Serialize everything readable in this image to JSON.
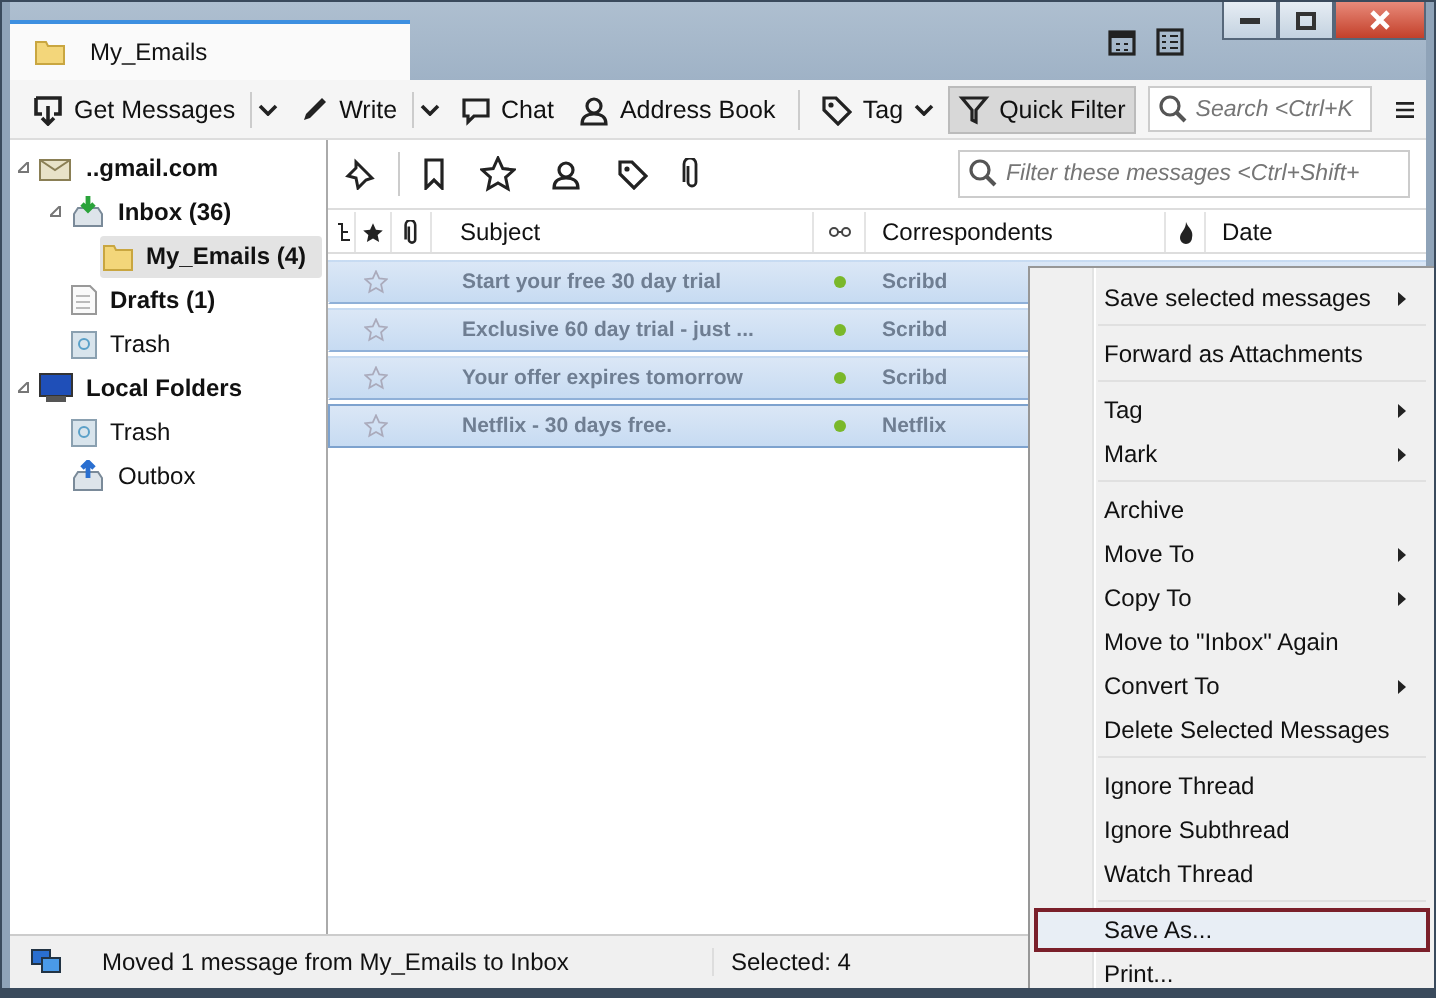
{
  "window": {
    "tab_title": "My_Emails"
  },
  "toolbar": {
    "buttons": [
      {
        "label": "Get Messages",
        "kind": "get",
        "dropdown": true
      },
      {
        "label": "Write",
        "kind": "write",
        "dropdown": true
      },
      {
        "label": "Chat",
        "kind": "chat",
        "dropdown": false
      },
      {
        "label": "Address Book",
        "kind": "contacts",
        "dropdown": false
      },
      {
        "label": "Tag",
        "kind": "tag",
        "dropdown": true
      },
      {
        "label": "Quick Filter",
        "kind": "filter",
        "dropdown": false,
        "on": true
      }
    ],
    "search": {
      "placeholder": "Search <Ctrl+K"
    }
  },
  "folders": [
    {
      "label": "..gmail.com",
      "kind": "account",
      "bold": true,
      "selected": false,
      "expanded": true,
      "children": [
        {
          "label": "Inbox (36)",
          "kind": "inbox",
          "bold": true,
          "selected": false,
          "expanded": true,
          "children": [
            {
              "label": "My_Emails (4)",
              "kind": "folder",
              "bold": true,
              "selected": true
            }
          ]
        },
        {
          "label": "Drafts (1)",
          "kind": "drafts",
          "bold": true,
          "selected": false
        },
        {
          "label": "Trash",
          "kind": "trash",
          "bold": false,
          "selected": false
        }
      ]
    },
    {
      "label": "Local Folders",
      "kind": "local",
      "bold": true,
      "selected": false,
      "expanded": true,
      "children": [
        {
          "label": "Trash",
          "kind": "trash",
          "bold": false,
          "selected": false
        },
        {
          "label": "Outbox",
          "kind": "outbox",
          "bold": false,
          "selected": false
        }
      ]
    }
  ],
  "filter": {
    "placeholder": "Filter these messages <Ctrl+Shift+"
  },
  "columns": [
    {
      "label": "Subject"
    },
    {
      "label": "Correspondents"
    },
    {
      "label": "Date"
    }
  ],
  "messages": [
    {
      "subject": "Start your free 30 day trial",
      "correspondent": "Scribd",
      "selected": true,
      "focused": false
    },
    {
      "subject": "Exclusive 60 day trial - just ...",
      "correspondent": "Scribd",
      "selected": true,
      "focused": false
    },
    {
      "subject": "Your offer expires tomorrow",
      "correspondent": "Scribd",
      "selected": true,
      "focused": false
    },
    {
      "subject": "Netflix - 30 days free.",
      "correspondent": "Netflix",
      "selected": true,
      "focused": true
    }
  ],
  "context_menu": {
    "groups": [
      [
        {
          "label": "Save selected messages",
          "submenu": true,
          "highlighted": false
        }
      ],
      [
        {
          "label": "Forward as Attachments",
          "submenu": false,
          "highlighted": false
        }
      ],
      [
        {
          "label": "Tag",
          "submenu": true,
          "highlighted": false
        },
        {
          "label": "Mark",
          "submenu": true,
          "highlighted": false
        }
      ],
      [
        {
          "label": "Archive",
          "submenu": false,
          "highlighted": false
        },
        {
          "label": "Move To",
          "submenu": true,
          "highlighted": false
        },
        {
          "label": "Copy To",
          "submenu": true,
          "highlighted": false
        },
        {
          "label": "Move to \"Inbox\" Again",
          "submenu": false,
          "highlighted": false
        },
        {
          "label": "Convert To",
          "submenu": true,
          "highlighted": false
        },
        {
          "label": "Delete Selected Messages",
          "submenu": false,
          "highlighted": false
        }
      ],
      [
        {
          "label": "Ignore Thread",
          "submenu": false,
          "highlighted": false
        },
        {
          "label": "Ignore Subthread",
          "submenu": false,
          "highlighted": false
        },
        {
          "label": "Watch Thread",
          "submenu": false,
          "highlighted": false
        }
      ],
      [
        {
          "label": "Save As...",
          "submenu": false,
          "highlighted": true
        },
        {
          "label": "Print...",
          "submenu": false,
          "highlighted": false
        }
      ]
    ]
  },
  "status_bar": {
    "message": "Moved 1 message from My_Emails to Inbox",
    "selected": "Selected: 4"
  }
}
